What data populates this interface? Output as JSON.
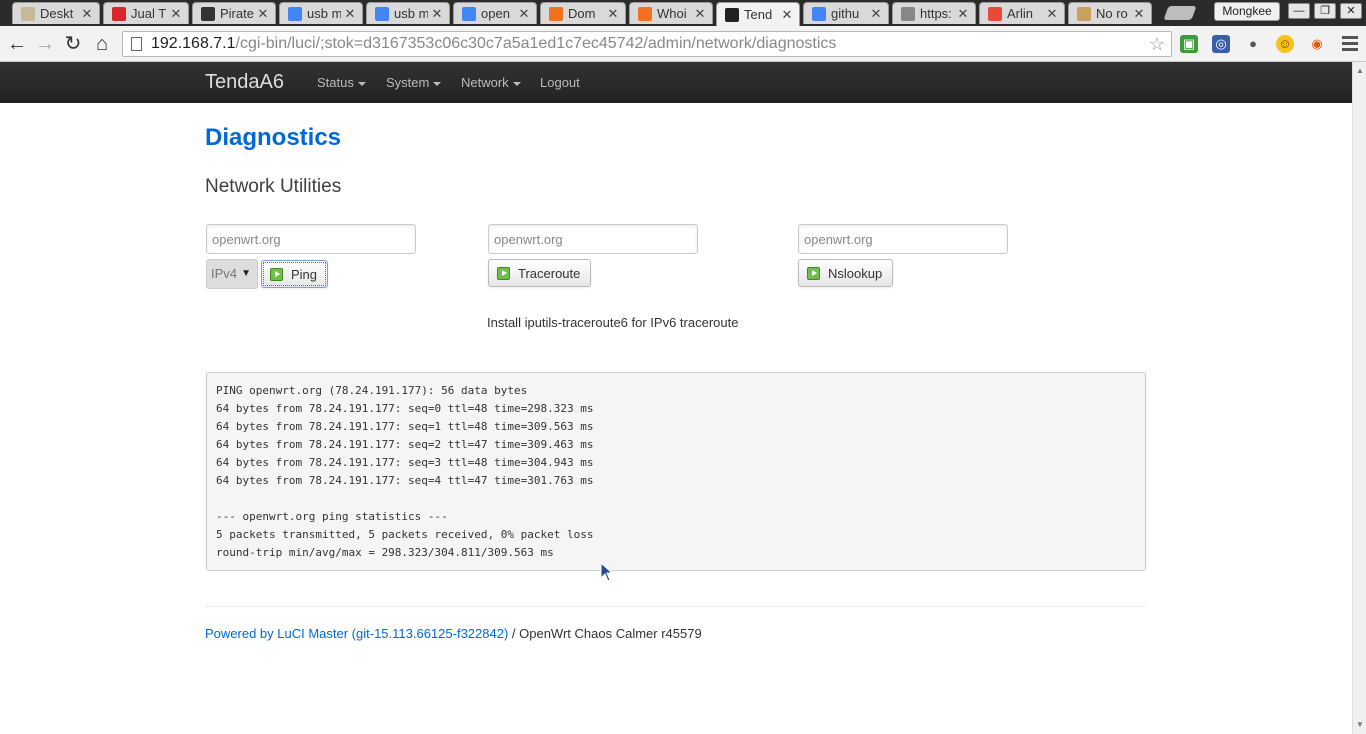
{
  "browser": {
    "tabs": [
      {
        "title": "Deskt",
        "favicon_color": "#c8b89a"
      },
      {
        "title": "Jual T",
        "favicon_color": "#d9262b"
      },
      {
        "title": "Pirate",
        "favicon_color": "#333333"
      },
      {
        "title": "usb m",
        "favicon_color": "#4285f4"
      },
      {
        "title": "usb m",
        "favicon_color": "#4285f4"
      },
      {
        "title": "open",
        "favicon_color": "#4285f4"
      },
      {
        "title": "Dom",
        "favicon_color": "#f36f21"
      },
      {
        "title": "Whoi",
        "favicon_color": "#f36f21"
      },
      {
        "title": "Tend",
        "favicon_color": "#222222"
      },
      {
        "title": "githu",
        "favicon_color": "#4285f4"
      },
      {
        "title": "https:",
        "favicon_color": "#888888"
      },
      {
        "title": "Arlin",
        "favicon_color": "#e84a3a"
      },
      {
        "title": "No ro",
        "favicon_color": "#c8a060"
      }
    ],
    "active_tab_index": 8,
    "close_glyph": "✕",
    "profile_name": "Mongkee",
    "url_host": "192.168.7.1",
    "url_path": "/cgi-bin/luci/;stok=d3167353c06c30c7a5a1ed1c7ec45742/admin/network/diagnostics"
  },
  "navbar": {
    "brand": "TendaA6",
    "items": [
      "Status",
      "System",
      "Network"
    ],
    "logout": "Logout"
  },
  "page": {
    "title": "Diagnostics",
    "section": "Network Utilities",
    "ping": {
      "host": "openwrt.org",
      "protocol": "IPv4",
      "button": "Ping"
    },
    "traceroute": {
      "host": "openwrt.org",
      "button": "Traceroute"
    },
    "nslookup": {
      "host": "openwrt.org",
      "button": "Nslookup"
    },
    "hint": "Install iputils-traceroute6 for IPv6 traceroute",
    "output_lines": [
      "PING openwrt.org (78.24.191.177): 56 data bytes",
      "64 bytes from 78.24.191.177: seq=0 ttl=48 time=298.323 ms",
      "64 bytes from 78.24.191.177: seq=1 ttl=48 time=309.563 ms",
      "64 bytes from 78.24.191.177: seq=2 ttl=47 time=309.463 ms",
      "64 bytes from 78.24.191.177: seq=3 ttl=48 time=304.943 ms",
      "64 bytes from 78.24.191.177: seq=4 ttl=47 time=301.763 ms",
      "",
      "--- openwrt.org ping statistics ---",
      "5 packets transmitted, 5 packets received, 0% packet loss",
      "round-trip min/avg/max = 298.323/304.811/309.563 ms"
    ]
  },
  "footer": {
    "link": "Powered by LuCI Master (git-15.113.66125-f322842)",
    "rest": " / OpenWrt Chaos Calmer r45579"
  },
  "colors": {
    "link": "#0069d6",
    "navbar": "#222222"
  }
}
